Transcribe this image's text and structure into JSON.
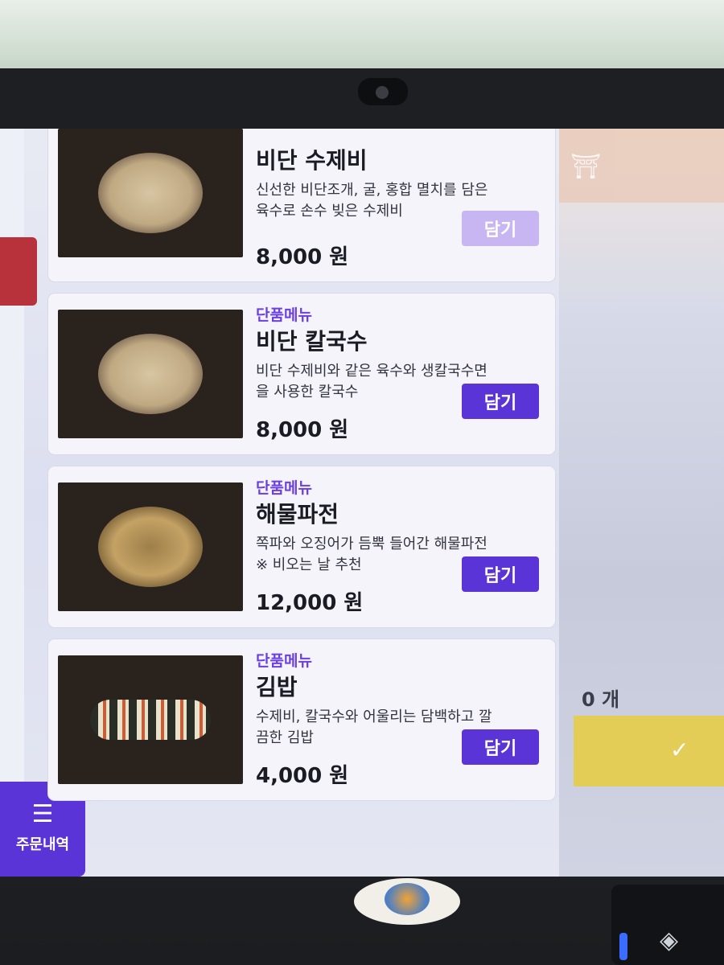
{
  "menu": {
    "items": [
      {
        "tag": "",
        "name": "비단 수제비",
        "desc_line1": "신선한 비단조개, 굴, 홍합 멸치를 담은",
        "desc_line2": "육수로 손수 빚은 수제비",
        "price": "8,000 원",
        "button": "담기"
      },
      {
        "tag": "단품메뉴",
        "name": "비단 칼국수",
        "desc_line1": "비단 수제비와 같은 육수와 생칼국수면",
        "desc_line2": "을 사용한 칼국수",
        "price": "8,000 원",
        "button": "담기"
      },
      {
        "tag": "단품메뉴",
        "name": "해물파전",
        "desc_line1": "쪽파와 오징어가 듬뿍 들어간 해물파전",
        "desc_line2": "※ 비오는 날 추천",
        "price": "12,000 원",
        "button": "담기"
      },
      {
        "tag": "단품메뉴",
        "name": "김밥",
        "desc_line1": "수제비, 칼국수와 어울리는 담백하고 깔",
        "desc_line2": "끔한 김밥",
        "price": "4,000 원",
        "button": "담기"
      }
    ]
  },
  "sidebar": {
    "order_history_label": "주문내역"
  },
  "cart": {
    "count": "0 개"
  },
  "colors": {
    "accent": "#5a34d6",
    "tag": "#6b3fe0",
    "yellow": "#e3cd57"
  }
}
